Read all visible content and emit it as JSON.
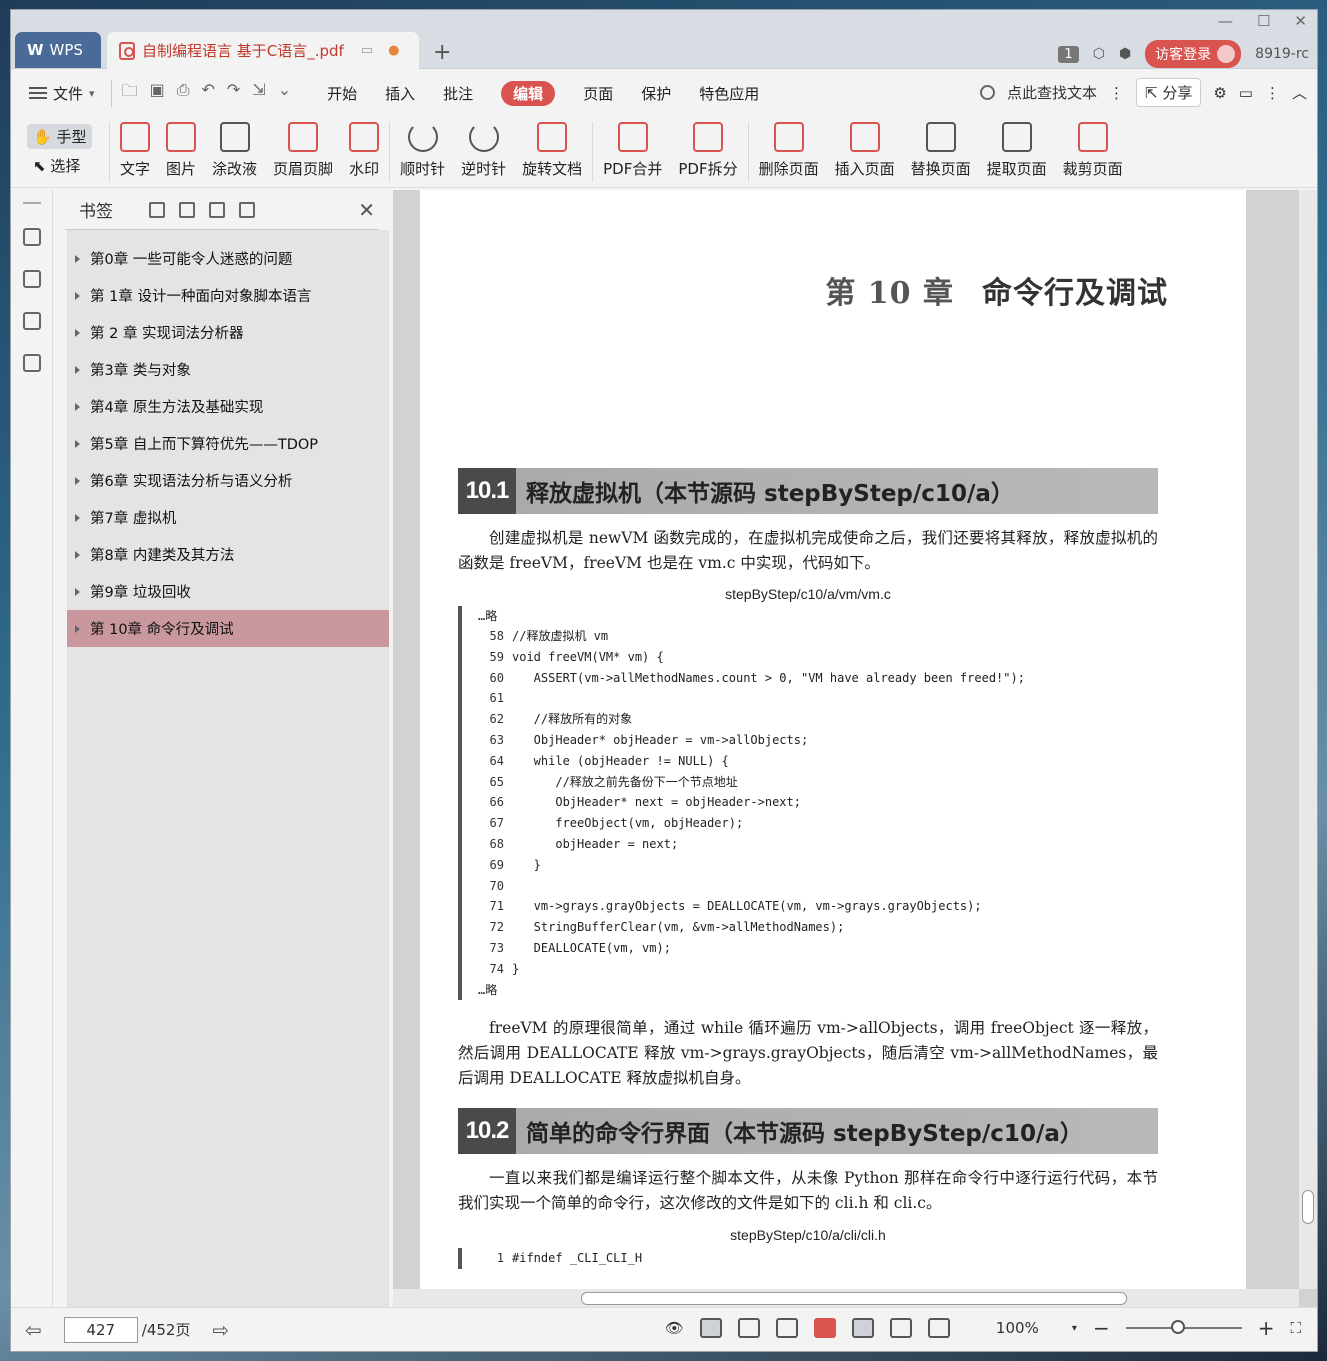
{
  "titlebar": {
    "app_tab": "WPS",
    "doc_tab": "自制编程语言 基于C语言_.pdf",
    "add_tab": "+",
    "page_badge": "1",
    "login": "访客登录",
    "user": "8919-rc"
  },
  "menubar": {
    "file": "文件",
    "tabs": [
      "开始",
      "插入",
      "批注",
      "编辑",
      "页面",
      "保护",
      "特色应用"
    ],
    "active_tab": "编辑",
    "search": "点此查找文本",
    "share": "分享"
  },
  "ribbon": {
    "hand": "手型",
    "select": "选择",
    "items": [
      "文字",
      "图片",
      "涂改液",
      "页眉页脚",
      "水印",
      "顺时针",
      "逆时针",
      "旋转文档",
      "PDF合并",
      "PDF拆分",
      "删除页面",
      "插入页面",
      "替换页面",
      "提取页面",
      "裁剪页面"
    ]
  },
  "bookmarks": {
    "title": "书签",
    "items": [
      "第0章 一些可能令人迷惑的问题",
      "第 1章 设计一种面向对象脚本语言",
      "第 2 章 实现词法分析器",
      "第3章 类与对象",
      "第4章 原生方法及基础实现",
      "第5章 自上而下算符优先——TDOP",
      "第6章 实现语法分析与语义分析",
      "第7章 虚拟机",
      "第8章 内建类及其方法",
      "第9章 垃圾回收",
      "第 10章 命令行及调试"
    ],
    "selected_index": 10
  },
  "page": {
    "chapter_num": "第 10 章",
    "chapter_title": "命令行及调试",
    "sec1_num": "10.1",
    "sec1_title": "释放虚拟机（本节源码 stepByStep/c10/a）",
    "para1": "创建虚拟机是 newVM 函数完成的，在虚拟机完成使命之后，我们还要将其释放，释放虚拟机的函数是 freeVM，freeVM 也是在 vm.c 中实现，代码如下。",
    "code1_caption": "stepByStep/c10/a/vm/vm.c",
    "ellipsis": "…略",
    "code1": [
      {
        "ln": "58",
        "text": "//释放虚拟机 vm"
      },
      {
        "ln": "59",
        "text": "void freeVM(VM* vm) {"
      },
      {
        "ln": "60",
        "text": "   ASSERT(vm->allMethodNames.count > 0, \"VM have already been freed!\");"
      },
      {
        "ln": "61",
        "text": ""
      },
      {
        "ln": "62",
        "text": "   //释放所有的对象"
      },
      {
        "ln": "63",
        "text": "   ObjHeader* objHeader = vm->allObjects;"
      },
      {
        "ln": "64",
        "text": "   while (objHeader != NULL) {"
      },
      {
        "ln": "65",
        "text": "      //释放之前先备份下一个节点地址"
      },
      {
        "ln": "66",
        "text": "      ObjHeader* next = objHeader->next;"
      },
      {
        "ln": "67",
        "text": "      freeObject(vm, objHeader);"
      },
      {
        "ln": "68",
        "text": "      objHeader = next;"
      },
      {
        "ln": "69",
        "text": "   }"
      },
      {
        "ln": "70",
        "text": ""
      },
      {
        "ln": "71",
        "text": "   vm->grays.grayObjects = DEALLOCATE(vm, vm->grays.grayObjects);"
      },
      {
        "ln": "72",
        "text": "   StringBufferClear(vm, &vm->allMethodNames);"
      },
      {
        "ln": "73",
        "text": "   DEALLOCATE(vm, vm);"
      },
      {
        "ln": "74",
        "text": "}"
      }
    ],
    "para2": "freeVM 的原理很简单，通过 while 循环遍历 vm->allObjects，调用 freeObject 逐一释放，然后调用 DEALLOCATE 释放 vm->grays.grayObjects，随后清空 vm->allMethodNames，最后调用 DEALLOCATE 释放虚拟机自身。",
    "sec2_num": "10.2",
    "sec2_title": "简单的命令行界面（本节源码 stepByStep/c10/a）",
    "para3": "一直以来我们都是编译运行整个脚本文件，从未像 Python 那样在命令行中逐行运行代码，本节我们实现一个简单的命令行，这次修改的文件是如下的 cli.h 和 cli.c。",
    "code2_caption": "stepByStep/c10/a/cli/cli.h",
    "code2": [
      {
        "ln": "1",
        "text": "#ifndef _CLI_CLI_H"
      }
    ]
  },
  "statusbar": {
    "page_current": "427",
    "page_total": "/452页",
    "zoom": "100%",
    "zoom_fraction": 0.45
  },
  "colors": {
    "accent": "#d9534f",
    "selected_bookmark": "#c9989f"
  }
}
